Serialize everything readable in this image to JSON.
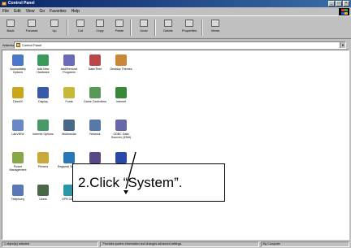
{
  "window": {
    "title": "Control Panel"
  },
  "menu": [
    "File",
    "Edit",
    "View",
    "Go",
    "Favorites",
    "Help"
  ],
  "toolbar": [
    "Back",
    "Forward",
    "Up",
    "Cut",
    "Copy",
    "Paste",
    "Undo",
    "Delete",
    "Properties",
    "Views"
  ],
  "address": {
    "label": "Address",
    "value": "Control Panel"
  },
  "items": [
    {
      "label": "Accessibility Options",
      "icon": "accessibility-icon",
      "color": "#4a78c8"
    },
    {
      "label": "Add New Hardware",
      "icon": "hardware-icon",
      "color": "#3a9a5a"
    },
    {
      "label": "Add/Remove Programs",
      "icon": "programs-icon",
      "color": "#6a6ab8"
    },
    {
      "label": "Date/Time",
      "icon": "clock-icon",
      "color": "#b84848"
    },
    {
      "label": "Desktop Themes",
      "icon": "themes-icon",
      "color": "#c88838"
    },
    {
      "label": "DirectX",
      "icon": "directx-icon",
      "color": "#c8a818"
    },
    {
      "label": "Display",
      "icon": "display-icon",
      "color": "#3858a8"
    },
    {
      "label": "Fonts",
      "icon": "fonts-icon",
      "color": "#c8b838"
    },
    {
      "label": "Game Controllers",
      "icon": "gamepad-icon",
      "color": "#589858"
    },
    {
      "label": "Internet",
      "icon": "internet-icon",
      "color": "#388838"
    },
    {
      "label": "LabVIEW",
      "icon": "labview-icon",
      "color": "#6888c8"
    },
    {
      "label": "Internet Options",
      "icon": "globe-icon",
      "color": "#489868"
    },
    {
      "label": "Multimedia",
      "icon": "multimedia-icon",
      "color": "#486888"
    },
    {
      "label": "Network",
      "icon": "network-icon",
      "color": "#5878a8"
    },
    {
      "label": "ODBC Data Sources (32bit)",
      "icon": "odbc-icon",
      "color": "#6868a8"
    },
    {
      "label": "Power Management",
      "icon": "power-icon",
      "color": "#88a848"
    },
    {
      "label": "Printers",
      "icon": "printer-icon",
      "color": "#c8a838"
    },
    {
      "label": "Regional Settings",
      "icon": "regional-icon",
      "color": "#2878b8"
    },
    {
      "label": "Sounds",
      "icon": "speaker-icon",
      "color": "#584888"
    },
    {
      "label": "System",
      "icon": "computer-icon",
      "color": "#2848a8"
    },
    {
      "label": "Telephony",
      "icon": "phone-icon",
      "color": "#5878b8"
    },
    {
      "label": "Users",
      "icon": "users-icon",
      "color": "#486848"
    },
    {
      "label": "VPN Client",
      "icon": "vpn-icon",
      "color": "#2898a8"
    }
  ],
  "callout": "2.Click “System”.",
  "status": {
    "left": "1 object(s) selected",
    "middle": "Provides system information and changes advanced settings.",
    "right": "My Computer"
  }
}
